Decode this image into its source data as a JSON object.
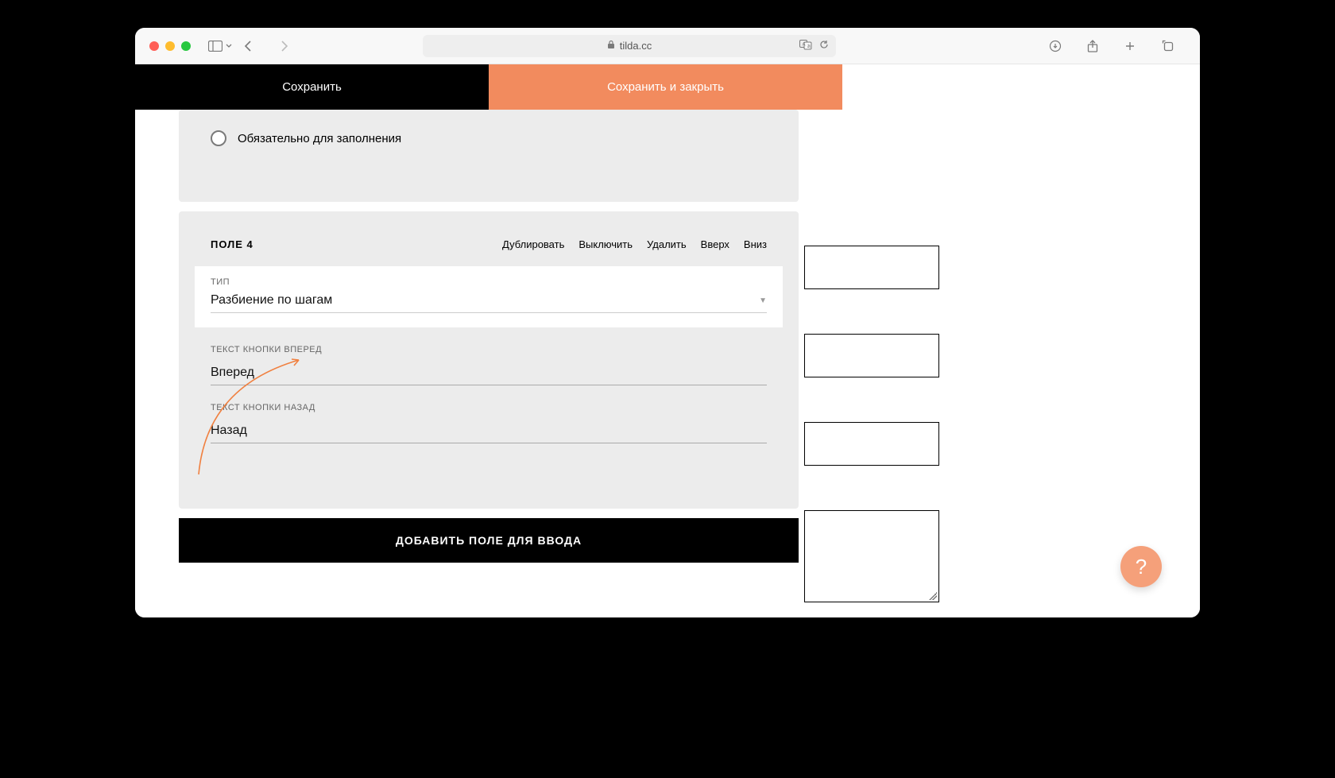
{
  "browser": {
    "url": "tilda.cc"
  },
  "topbar": {
    "save": "Сохранить",
    "save_close": "Сохранить и закрыть"
  },
  "prev_panel": {
    "required_label": "Обязательно для заполнения"
  },
  "field4": {
    "title": "ПОЛЕ 4",
    "actions": {
      "duplicate": "Дублировать",
      "disable": "Выключить",
      "delete": "Удалить",
      "up": "Вверх",
      "down": "Вниз"
    },
    "type_label": "ТИП",
    "type_value": "Разбиение по шагам",
    "fwd_label": "ТЕКСТ КНОПКИ ВПЕРЕД",
    "fwd_value": "Вперед",
    "back_label": "ТЕКСТ КНОПКИ НАЗАД",
    "back_value": "Назад"
  },
  "add_button": "ДОБАВИТЬ ПОЛЕ ДЛЯ ВВОДА",
  "help": "?"
}
